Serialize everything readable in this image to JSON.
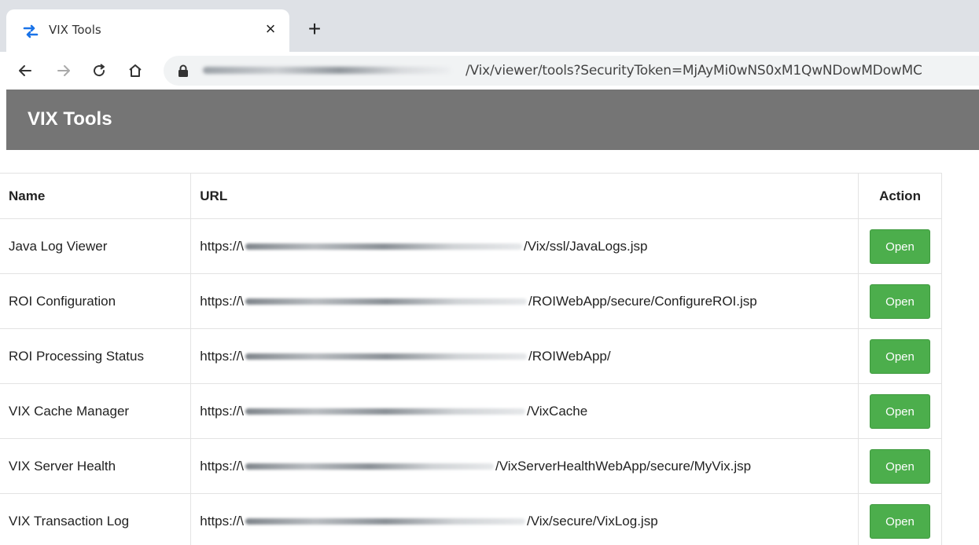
{
  "browser": {
    "tab": {
      "title": "VIX Tools",
      "close_glyph": "×",
      "favicon": "swap-arrows-icon",
      "favicon_color": "#1a73e8"
    },
    "new_tab_glyph": "+",
    "address": {
      "visible_url": "/Vix/viewer/tools?SecurityToken=MjAyMi0wNS0xM1QwNDowMDowMC"
    }
  },
  "header": {
    "title": "VIX Tools",
    "background": "#757575"
  },
  "table": {
    "columns": [
      "Name",
      "URL",
      "Action"
    ],
    "rows": [
      {
        "name": "Java Log Viewer",
        "url_prefix": "https://\\",
        "url_suffix": "/Vix/ssl/JavaLogs.jsp",
        "action": "Open"
      },
      {
        "name": "ROI Configuration",
        "url_prefix": "https://\\",
        "url_suffix": "/ROIWebApp/secure/ConfigureROI.jsp",
        "action": "Open"
      },
      {
        "name": "ROI Processing Status",
        "url_prefix": "https://\\",
        "url_suffix": "/ROIWebApp/",
        "action": "Open"
      },
      {
        "name": "VIX Cache Manager",
        "url_prefix": "https://\\",
        "url_suffix": "/VixCache",
        "action": "Open"
      },
      {
        "name": "VIX Server Health",
        "url_prefix": "https://\\",
        "url_suffix": "/VixServerHealthWebApp/secure/MyVix.jsp",
        "action": "Open"
      },
      {
        "name": "VIX Transaction Log",
        "url_prefix": "https://\\",
        "url_suffix": "/Vix/secure/VixLog.jsp",
        "action": "Open"
      }
    ]
  },
  "colors": {
    "open_button": "#4cae4c",
    "tab_strip": "#dee1e6",
    "omnibox": "#f1f3f4"
  }
}
